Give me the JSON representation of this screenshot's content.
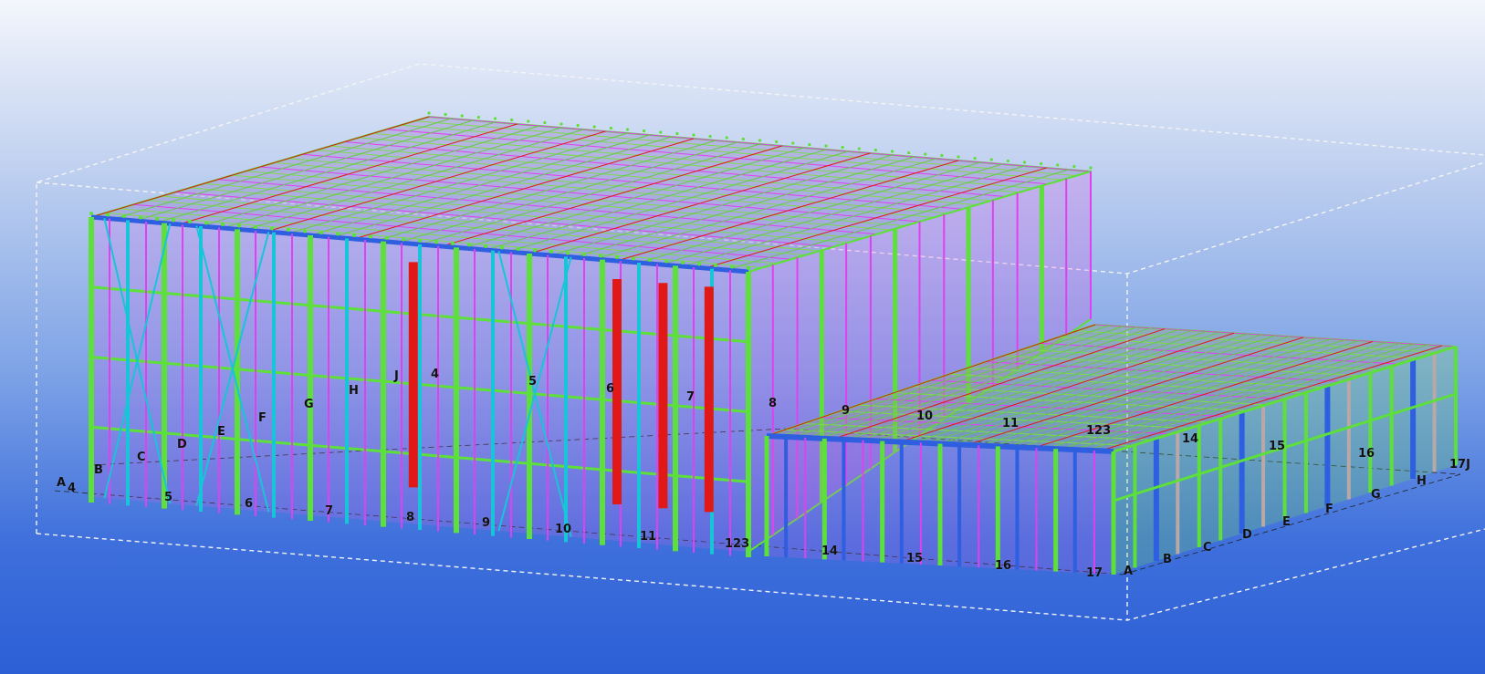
{
  "viewer": {
    "background_top": "#f3f6fc",
    "background_bottom": "#2c5fd6"
  },
  "colors": {
    "column_green": "#5de03a",
    "brace_magenta": "#e040f0",
    "beam_cyan": "#18c4d8",
    "beam_blue": "#2d5fe0",
    "column_red": "#e01818",
    "column_grey": "#b8a8a8",
    "gridline": "#222222",
    "bounding_box": "#f4f4f4"
  },
  "grid_labels": {
    "main_front": [
      "A",
      "4",
      "B",
      "C",
      "D",
      "E",
      "F",
      "G",
      "H",
      "J",
      "4",
      "5",
      "6",
      "7",
      "8",
      "9",
      "10",
      "11",
      "123",
      "5",
      "6",
      "7",
      "8",
      "9"
    ],
    "main_axis": [
      "5",
      "6",
      "7",
      "8",
      "9",
      "10",
      "11",
      "123"
    ],
    "annex_axis": [
      "14",
      "15",
      "16",
      "17"
    ],
    "annex_rows": [
      "A",
      "B",
      "C",
      "D",
      "E",
      "F",
      "G",
      "H",
      "17J"
    ],
    "annex_roof": [
      "10",
      "11",
      "123",
      "14",
      "15",
      "16"
    ]
  }
}
